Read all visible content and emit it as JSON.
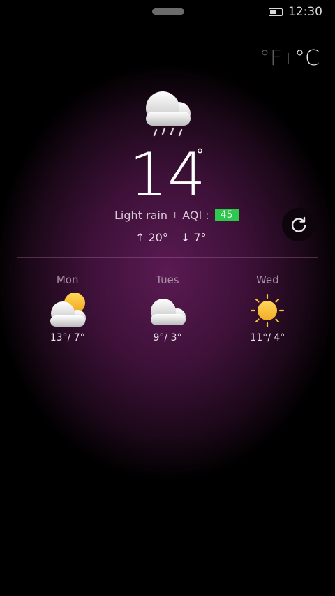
{
  "status_bar": {
    "time": "12:30",
    "battery_icon": "battery-icon"
  },
  "units": {
    "fahrenheit": "°F",
    "separator": "I",
    "celsius": "°C",
    "active": "celsius"
  },
  "current": {
    "icon": "rain-cloud-icon",
    "temperature": "14",
    "degree_symbol": "°",
    "condition": "Light rain",
    "separator": "I",
    "aqi_label": "AQI :",
    "aqi_value": "45",
    "aqi_color": "#2dc84d",
    "high": "↑ 20°",
    "low": "↓ 7°"
  },
  "refresh": {
    "icon": "refresh-icon"
  },
  "forecast": [
    {
      "day": "Mon",
      "icon": "partly-cloudy-icon",
      "temps": "13°/ 7°"
    },
    {
      "day": "Tues",
      "icon": "cloud-icon",
      "temps": "9°/ 3°"
    },
    {
      "day": "Wed",
      "icon": "sun-icon",
      "temps": "11°/ 4°"
    }
  ],
  "colors": {
    "background_glow": "#5a1a52",
    "sun": "#f5c23a"
  }
}
